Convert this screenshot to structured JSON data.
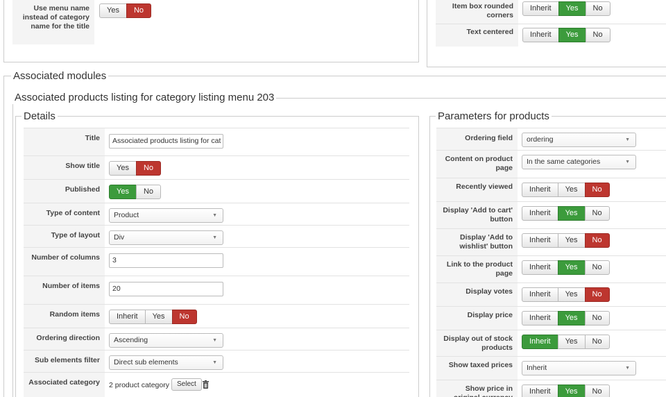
{
  "top_left": {
    "menu_name_label": "Use menu name instead of category name for the title",
    "menu_name_yes": "Yes",
    "menu_name_no": "No"
  },
  "top_right": {
    "rounded_label": "Item box rounded corners",
    "centered_label": "Text centered",
    "inherit": "Inherit",
    "yes": "Yes",
    "no": "No"
  },
  "associated_modules_legend": "Associated modules",
  "module_legend": "Associated products listing for category listing menu 203",
  "details": {
    "legend": "Details",
    "title_label": "Title",
    "title_value": "Associated products listing for cat",
    "show_title_label": "Show title",
    "published_label": "Published",
    "type_content_label": "Type of content",
    "type_content_value": "Product",
    "type_layout_label": "Type of layout",
    "type_layout_value": "Div",
    "num_columns_label": "Number of columns",
    "num_columns_value": "3",
    "num_items_label": "Number of items",
    "num_items_value": "20",
    "random_label": "Random items",
    "ordering_dir_label": "Ordering direction",
    "ordering_dir_value": "Ascending",
    "sub_filter_label": "Sub elements filter",
    "sub_filter_value": "Direct sub elements",
    "assoc_cat_label": "Associated category",
    "assoc_cat_value": "2 product category",
    "select_label": "Select",
    "inherit": "Inherit",
    "yes": "Yes",
    "no": "No"
  },
  "params": {
    "legend": "Parameters for products",
    "ordering_field_label": "Ordering field",
    "ordering_field_value": "ordering",
    "content_label": "Content on product page",
    "content_value": "In the same categories",
    "recently_label": "Recently viewed",
    "cart_label": "Display 'Add to cart' button",
    "wishlist_label": "Display 'Add to wishlist' button",
    "link_label": "Link to the product page",
    "votes_label": "Display votes",
    "price_label": "Display price",
    "stock_label": "Display out of stock products",
    "taxed_label": "Show taxed prices",
    "taxed_value": "Inherit",
    "orig_label": "Show price in original currency",
    "inherit": "Inherit",
    "yes": "Yes",
    "no": "No"
  }
}
